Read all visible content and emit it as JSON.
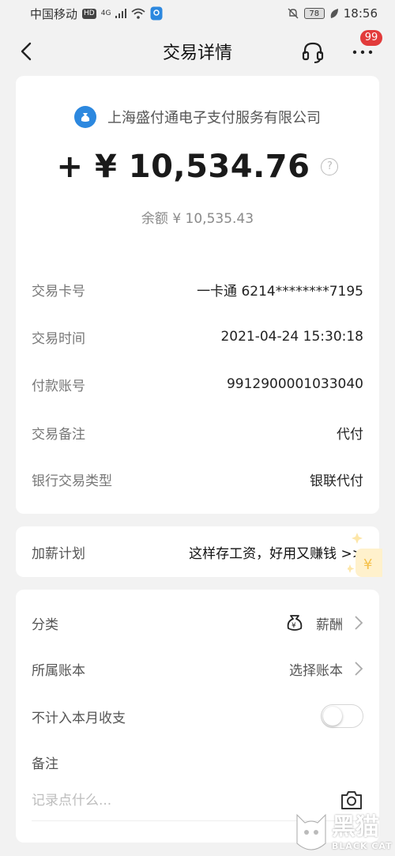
{
  "status_bar": {
    "carrier": "中国移动",
    "hd_badge": "HD",
    "network": "4G",
    "battery_level": "78",
    "time": "18:56",
    "icons": [
      "signal-icon",
      "wifi-icon",
      "location-icon",
      "mute-bell-icon",
      "battery-icon",
      "leaf-icon"
    ]
  },
  "nav": {
    "title": "交易详情",
    "badge_count": "99",
    "icons": [
      "back-icon",
      "headset-icon",
      "more-icon"
    ]
  },
  "transaction": {
    "merchant": "上海盛付通电子支付服务有限公司",
    "amount": "+ ¥ 10,534.76",
    "balance": "余额 ¥ 10,535.43",
    "details": [
      {
        "label": "交易卡号",
        "value": "一卡通 6214********7195"
      },
      {
        "label": "交易时间",
        "value": "2021-04-24 15:30:18"
      },
      {
        "label": "付款账号",
        "value": "9912900001033040"
      },
      {
        "label": "交易备注",
        "value": "代付"
      },
      {
        "label": "银行交易类型",
        "value": "银联代付"
      }
    ]
  },
  "promo": {
    "label": "加薪计划",
    "text": "这样存工资，好用又赚钱 >>"
  },
  "settings": {
    "category": {
      "label": "分类",
      "value": "薪酬"
    },
    "ledger": {
      "label": "所属账本",
      "value": "选择账本"
    },
    "exclude": {
      "label": "不计入本月收支",
      "enabled": false
    },
    "note": {
      "label": "备注",
      "placeholder": "记录点什么..."
    }
  },
  "watermark": {
    "cn": "黑猫",
    "en": "BLACK CAT"
  },
  "colors": {
    "accent_blue": "#2c88df",
    "badge_red": "#e23b3b",
    "background": "#f2f2f2"
  }
}
